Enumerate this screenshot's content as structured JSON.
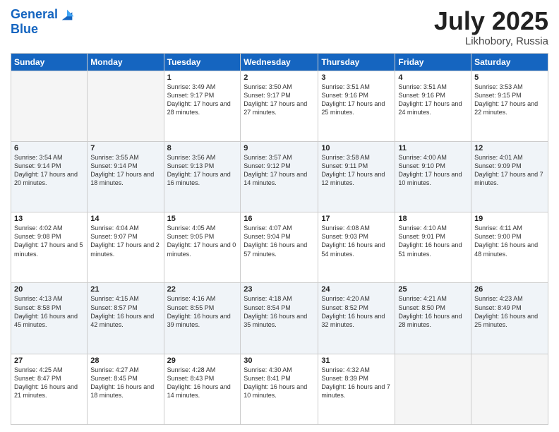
{
  "header": {
    "logo_line1": "General",
    "logo_line2": "Blue",
    "month_title": "July 2025",
    "location": "Likhobory, Russia"
  },
  "weekdays": [
    "Sunday",
    "Monday",
    "Tuesday",
    "Wednesday",
    "Thursday",
    "Friday",
    "Saturday"
  ],
  "weeks": [
    [
      {
        "day": "",
        "empty": true
      },
      {
        "day": "",
        "empty": true
      },
      {
        "day": "1",
        "sunrise": "Sunrise: 3:49 AM",
        "sunset": "Sunset: 9:17 PM",
        "daylight": "Daylight: 17 hours and 28 minutes."
      },
      {
        "day": "2",
        "sunrise": "Sunrise: 3:50 AM",
        "sunset": "Sunset: 9:17 PM",
        "daylight": "Daylight: 17 hours and 27 minutes."
      },
      {
        "day": "3",
        "sunrise": "Sunrise: 3:51 AM",
        "sunset": "Sunset: 9:16 PM",
        "daylight": "Daylight: 17 hours and 25 minutes."
      },
      {
        "day": "4",
        "sunrise": "Sunrise: 3:51 AM",
        "sunset": "Sunset: 9:16 PM",
        "daylight": "Daylight: 17 hours and 24 minutes."
      },
      {
        "day": "5",
        "sunrise": "Sunrise: 3:53 AM",
        "sunset": "Sunset: 9:15 PM",
        "daylight": "Daylight: 17 hours and 22 minutes."
      }
    ],
    [
      {
        "day": "6",
        "sunrise": "Sunrise: 3:54 AM",
        "sunset": "Sunset: 9:14 PM",
        "daylight": "Daylight: 17 hours and 20 minutes."
      },
      {
        "day": "7",
        "sunrise": "Sunrise: 3:55 AM",
        "sunset": "Sunset: 9:14 PM",
        "daylight": "Daylight: 17 hours and 18 minutes."
      },
      {
        "day": "8",
        "sunrise": "Sunrise: 3:56 AM",
        "sunset": "Sunset: 9:13 PM",
        "daylight": "Daylight: 17 hours and 16 minutes."
      },
      {
        "day": "9",
        "sunrise": "Sunrise: 3:57 AM",
        "sunset": "Sunset: 9:12 PM",
        "daylight": "Daylight: 17 hours and 14 minutes."
      },
      {
        "day": "10",
        "sunrise": "Sunrise: 3:58 AM",
        "sunset": "Sunset: 9:11 PM",
        "daylight": "Daylight: 17 hours and 12 minutes."
      },
      {
        "day": "11",
        "sunrise": "Sunrise: 4:00 AM",
        "sunset": "Sunset: 9:10 PM",
        "daylight": "Daylight: 17 hours and 10 minutes."
      },
      {
        "day": "12",
        "sunrise": "Sunrise: 4:01 AM",
        "sunset": "Sunset: 9:09 PM",
        "daylight": "Daylight: 17 hours and 7 minutes."
      }
    ],
    [
      {
        "day": "13",
        "sunrise": "Sunrise: 4:02 AM",
        "sunset": "Sunset: 9:08 PM",
        "daylight": "Daylight: 17 hours and 5 minutes."
      },
      {
        "day": "14",
        "sunrise": "Sunrise: 4:04 AM",
        "sunset": "Sunset: 9:07 PM",
        "daylight": "Daylight: 17 hours and 2 minutes."
      },
      {
        "day": "15",
        "sunrise": "Sunrise: 4:05 AM",
        "sunset": "Sunset: 9:05 PM",
        "daylight": "Daylight: 17 hours and 0 minutes."
      },
      {
        "day": "16",
        "sunrise": "Sunrise: 4:07 AM",
        "sunset": "Sunset: 9:04 PM",
        "daylight": "Daylight: 16 hours and 57 minutes."
      },
      {
        "day": "17",
        "sunrise": "Sunrise: 4:08 AM",
        "sunset": "Sunset: 9:03 PM",
        "daylight": "Daylight: 16 hours and 54 minutes."
      },
      {
        "day": "18",
        "sunrise": "Sunrise: 4:10 AM",
        "sunset": "Sunset: 9:01 PM",
        "daylight": "Daylight: 16 hours and 51 minutes."
      },
      {
        "day": "19",
        "sunrise": "Sunrise: 4:11 AM",
        "sunset": "Sunset: 9:00 PM",
        "daylight": "Daylight: 16 hours and 48 minutes."
      }
    ],
    [
      {
        "day": "20",
        "sunrise": "Sunrise: 4:13 AM",
        "sunset": "Sunset: 8:58 PM",
        "daylight": "Daylight: 16 hours and 45 minutes."
      },
      {
        "day": "21",
        "sunrise": "Sunrise: 4:15 AM",
        "sunset": "Sunset: 8:57 PM",
        "daylight": "Daylight: 16 hours and 42 minutes."
      },
      {
        "day": "22",
        "sunrise": "Sunrise: 4:16 AM",
        "sunset": "Sunset: 8:55 PM",
        "daylight": "Daylight: 16 hours and 39 minutes."
      },
      {
        "day": "23",
        "sunrise": "Sunrise: 4:18 AM",
        "sunset": "Sunset: 8:54 PM",
        "daylight": "Daylight: 16 hours and 35 minutes."
      },
      {
        "day": "24",
        "sunrise": "Sunrise: 4:20 AM",
        "sunset": "Sunset: 8:52 PM",
        "daylight": "Daylight: 16 hours and 32 minutes."
      },
      {
        "day": "25",
        "sunrise": "Sunrise: 4:21 AM",
        "sunset": "Sunset: 8:50 PM",
        "daylight": "Daylight: 16 hours and 28 minutes."
      },
      {
        "day": "26",
        "sunrise": "Sunrise: 4:23 AM",
        "sunset": "Sunset: 8:49 PM",
        "daylight": "Daylight: 16 hours and 25 minutes."
      }
    ],
    [
      {
        "day": "27",
        "sunrise": "Sunrise: 4:25 AM",
        "sunset": "Sunset: 8:47 PM",
        "daylight": "Daylight: 16 hours and 21 minutes."
      },
      {
        "day": "28",
        "sunrise": "Sunrise: 4:27 AM",
        "sunset": "Sunset: 8:45 PM",
        "daylight": "Daylight: 16 hours and 18 minutes."
      },
      {
        "day": "29",
        "sunrise": "Sunrise: 4:28 AM",
        "sunset": "Sunset: 8:43 PM",
        "daylight": "Daylight: 16 hours and 14 minutes."
      },
      {
        "day": "30",
        "sunrise": "Sunrise: 4:30 AM",
        "sunset": "Sunset: 8:41 PM",
        "daylight": "Daylight: 16 hours and 10 minutes."
      },
      {
        "day": "31",
        "sunrise": "Sunrise: 4:32 AM",
        "sunset": "Sunset: 8:39 PM",
        "daylight": "Daylight: 16 hours and 7 minutes."
      },
      {
        "day": "",
        "empty": true
      },
      {
        "day": "",
        "empty": true
      }
    ]
  ]
}
